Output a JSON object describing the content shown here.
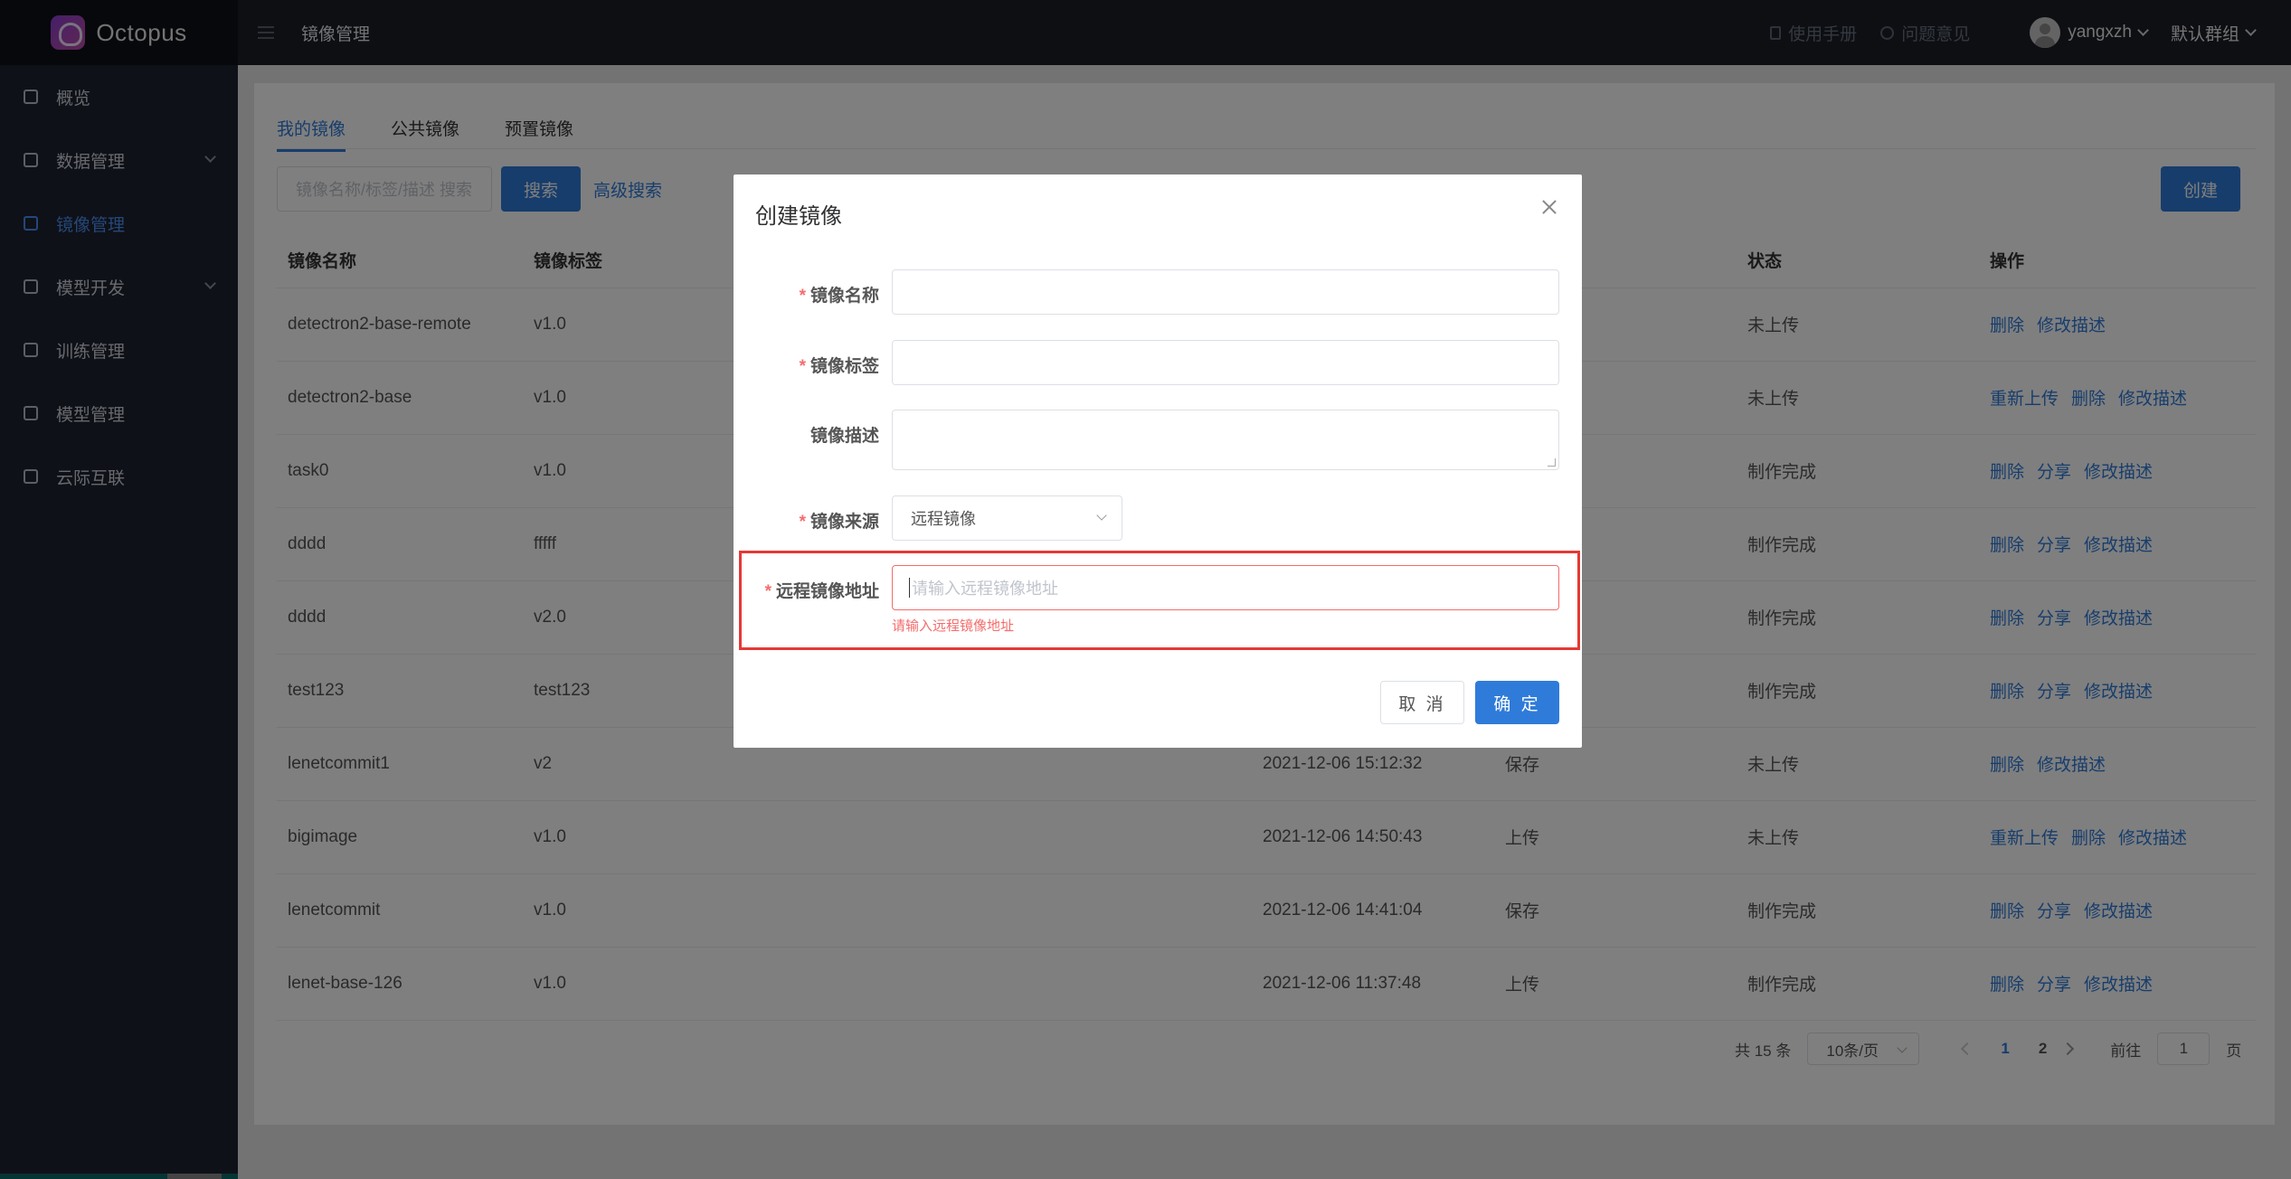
{
  "app": {
    "name": "Octopus"
  },
  "sidebar": {
    "items": [
      {
        "label": "概览",
        "icon": "dashboard-icon"
      },
      {
        "label": "数据管理",
        "icon": "database-icon",
        "expandable": true
      },
      {
        "label": "镜像管理",
        "icon": "image-icon",
        "active": true
      },
      {
        "label": "模型开发",
        "icon": "grid-icon",
        "expandable": true
      },
      {
        "label": "训练管理",
        "icon": "file-icon"
      },
      {
        "label": "模型管理",
        "icon": "cube-icon"
      },
      {
        "label": "云际互联",
        "icon": "network-icon"
      }
    ]
  },
  "topbar": {
    "breadcrumb": "镜像管理",
    "manual": "使用手册",
    "feedback": "问题意见",
    "username": "yangxzh",
    "group": "默认群组"
  },
  "tabs": [
    "我的镜像",
    "公共镜像",
    "预置镜像"
  ],
  "toolbar": {
    "search_placeholder": "镜像名称/标签/描述 搜索",
    "search_button": "搜索",
    "advanced_search": "高级搜索",
    "create_button": "创建"
  },
  "table": {
    "headers": [
      "镜像名称",
      "镜像标签",
      "",
      "",
      "状态",
      "操作"
    ],
    "rows": [
      {
        "name": "detectron2-base-remote",
        "tag": "v1.0",
        "time": "",
        "type": "",
        "status": "未上传",
        "ops": [
          "删除",
          "修改描述"
        ]
      },
      {
        "name": "detectron2-base",
        "tag": "v1.0",
        "time": "",
        "type": "",
        "status": "未上传",
        "ops": [
          "重新上传",
          "删除",
          "修改描述"
        ]
      },
      {
        "name": "task0",
        "tag": "v1.0",
        "time": "",
        "type": "",
        "status": "制作完成",
        "ops": [
          "删除",
          "分享",
          "修改描述"
        ]
      },
      {
        "name": "dddd",
        "tag": "fffff",
        "time": "",
        "type": "",
        "status": "制作完成",
        "ops": [
          "删除",
          "分享",
          "修改描述"
        ]
      },
      {
        "name": "dddd",
        "tag": "v2.0",
        "time": "",
        "type": "",
        "status": "制作完成",
        "ops": [
          "删除",
          "分享",
          "修改描述"
        ]
      },
      {
        "name": "test123",
        "tag": "test123",
        "time": "",
        "type": "",
        "status": "制作完成",
        "ops": [
          "删除",
          "分享",
          "修改描述"
        ]
      },
      {
        "name": "lenetcommit1",
        "tag": "v2",
        "time": "2021-12-06 15:12:32",
        "type": "保存",
        "status": "未上传",
        "ops": [
          "删除",
          "修改描述"
        ]
      },
      {
        "name": "bigimage",
        "tag": "v1.0",
        "time": "2021-12-06 14:50:43",
        "type": "上传",
        "status": "未上传",
        "ops": [
          "重新上传",
          "删除",
          "修改描述"
        ]
      },
      {
        "name": "lenetcommit",
        "tag": "v1.0",
        "time": "2021-12-06 14:41:04",
        "type": "保存",
        "status": "制作完成",
        "ops": [
          "删除",
          "分享",
          "修改描述"
        ]
      },
      {
        "name": "lenet-base-126",
        "tag": "v1.0",
        "time": "2021-12-06 11:37:48",
        "type": "上传",
        "status": "制作完成",
        "ops": [
          "删除",
          "分享",
          "修改描述"
        ]
      }
    ]
  },
  "pagination": {
    "total": "共 15 条",
    "page_size": "10条/页",
    "pages": [
      "1",
      "2"
    ],
    "current": "1",
    "goto_label": "前往",
    "goto_value": "1",
    "goto_suffix": "页"
  },
  "dialog": {
    "title": "创建镜像",
    "fields": {
      "name_label": "镜像名称",
      "tag_label": "镜像标签",
      "desc_label": "镜像描述",
      "source_label": "镜像来源",
      "source_value": "远程镜像",
      "remote_label": "远程镜像地址",
      "remote_placeholder": "请输入远程镜像地址",
      "remote_error": "请输入远程镜像地址"
    },
    "required_mark": "*",
    "cancel": "取 消",
    "confirm": "确 定"
  }
}
